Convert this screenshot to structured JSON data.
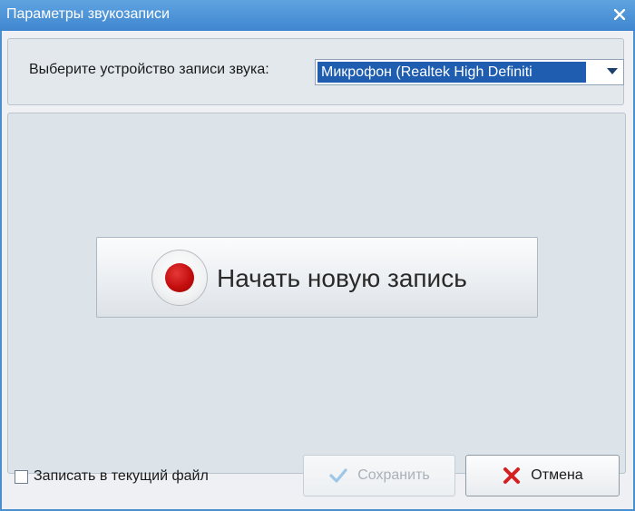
{
  "window": {
    "title": "Параметры звукозаписи"
  },
  "device": {
    "label": "Выберите устройство записи звука:",
    "selected_value": "Микрофон (Realtek High Definiti"
  },
  "record": {
    "button_label": "Начать новую запись"
  },
  "footer": {
    "checkbox_label": "Записать в текущий файл",
    "checkbox_checked": false,
    "save_label": "Сохранить",
    "save_enabled": false,
    "cancel_label": "Отмена"
  },
  "icons": {
    "close": "close-icon",
    "dropdown": "chevron-down-icon",
    "record": "record-icon",
    "save": "checkmark-icon",
    "cancel": "red-x-icon"
  },
  "colors": {
    "titlebar": "#4a90d0",
    "select_highlight": "#1e5db0",
    "record_red": "#c40e0e",
    "cancel_red": "#d42020",
    "save_check_disabled": "#9ec6e6"
  }
}
